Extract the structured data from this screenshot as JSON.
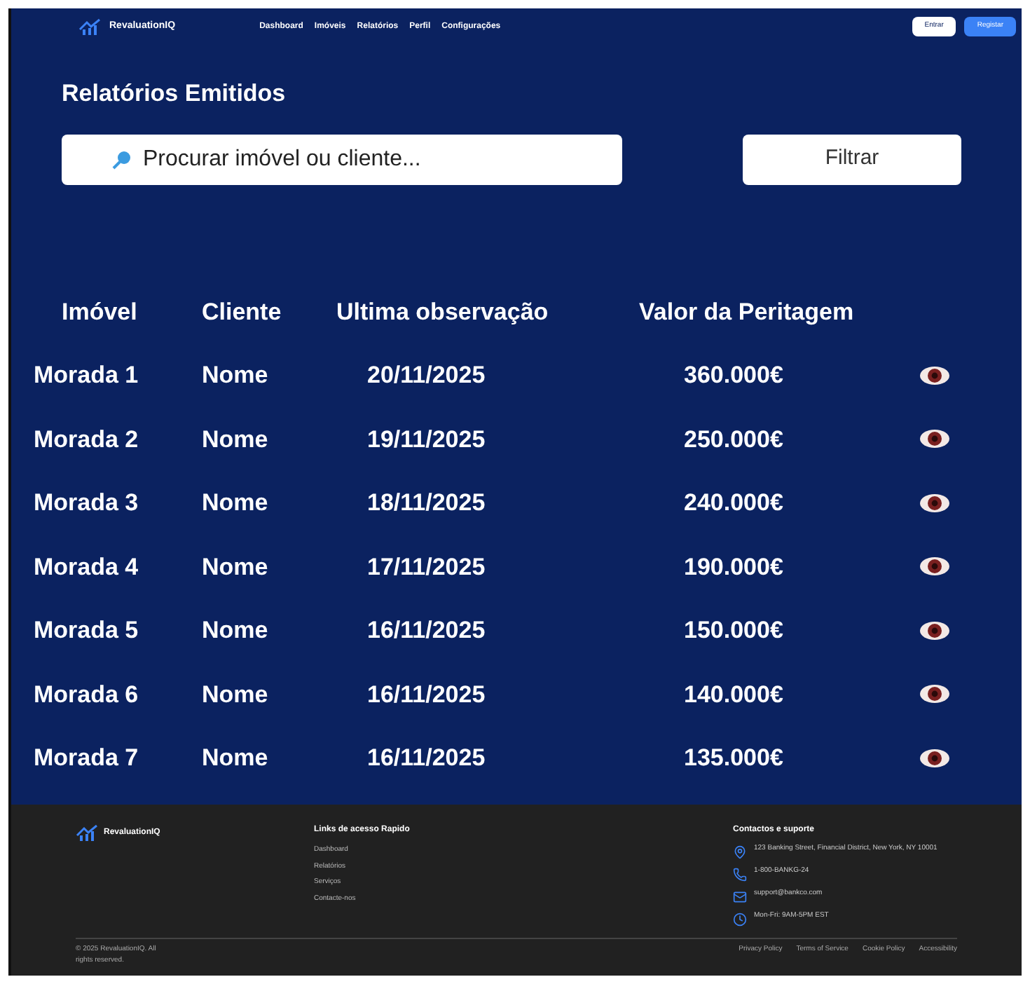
{
  "nav": {
    "brand": "RevaluationIQ",
    "links": [
      "Dashboard",
      "Imóveis",
      "Relatórios",
      "Perfil",
      "Configurações"
    ],
    "login": "Entrar",
    "register": "Registar"
  },
  "title": "Relatórios Emitidos",
  "search": {
    "placeholder": "Procurar imóvel ou cliente..."
  },
  "filter": "Filtrar",
  "table": {
    "columns": [
      "Imóvel",
      "Cliente",
      "Ultima observação",
      "Valor da Peritagem"
    ],
    "rows": [
      {
        "property": "Morada 1",
        "client": "Nome",
        "date": "20/11/2025",
        "value": "360.000€"
      },
      {
        "property": "Morada 2",
        "client": "Nome",
        "date": "19/11/2025",
        "value": "250.000€"
      },
      {
        "property": "Morada 3",
        "client": "Nome",
        "date": "18/11/2025",
        "value": "240.000€"
      },
      {
        "property": "Morada 4",
        "client": "Nome",
        "date": "17/11/2025",
        "value": "190.000€"
      },
      {
        "property": "Morada 5",
        "client": "Nome",
        "date": "16/11/2025",
        "value": "150.000€"
      },
      {
        "property": "Morada 6",
        "client": "Nome",
        "date": "16/11/2025",
        "value": "140.000€"
      },
      {
        "property": "Morada 7",
        "client": "Nome",
        "date": "16/11/2025",
        "value": "135.000€"
      }
    ]
  },
  "footer": {
    "brand": "RevaluationIQ",
    "links_title": "Links de acesso Rapido",
    "links": [
      "Dashboard",
      "Relatórios",
      "Serviços",
      "Contacte-nos"
    ],
    "contact_title": "Contactos e suporte",
    "contacts": [
      {
        "kind": "address",
        "text": "123 Banking Street, Financial District, New York, NY 10001"
      },
      {
        "kind": "phone",
        "text": "1-800-BANKG-24"
      },
      {
        "kind": "email",
        "text": "support@bankco.com"
      },
      {
        "kind": "hours",
        "text": "Mon-Fri: 9AM-5PM EST"
      }
    ],
    "copyright": "© 2025 RevaluationIQ. All rights reserved.",
    "legal": [
      "Privacy Policy",
      "Terms of Service",
      "Cookie Policy",
      "Accessibility"
    ]
  }
}
